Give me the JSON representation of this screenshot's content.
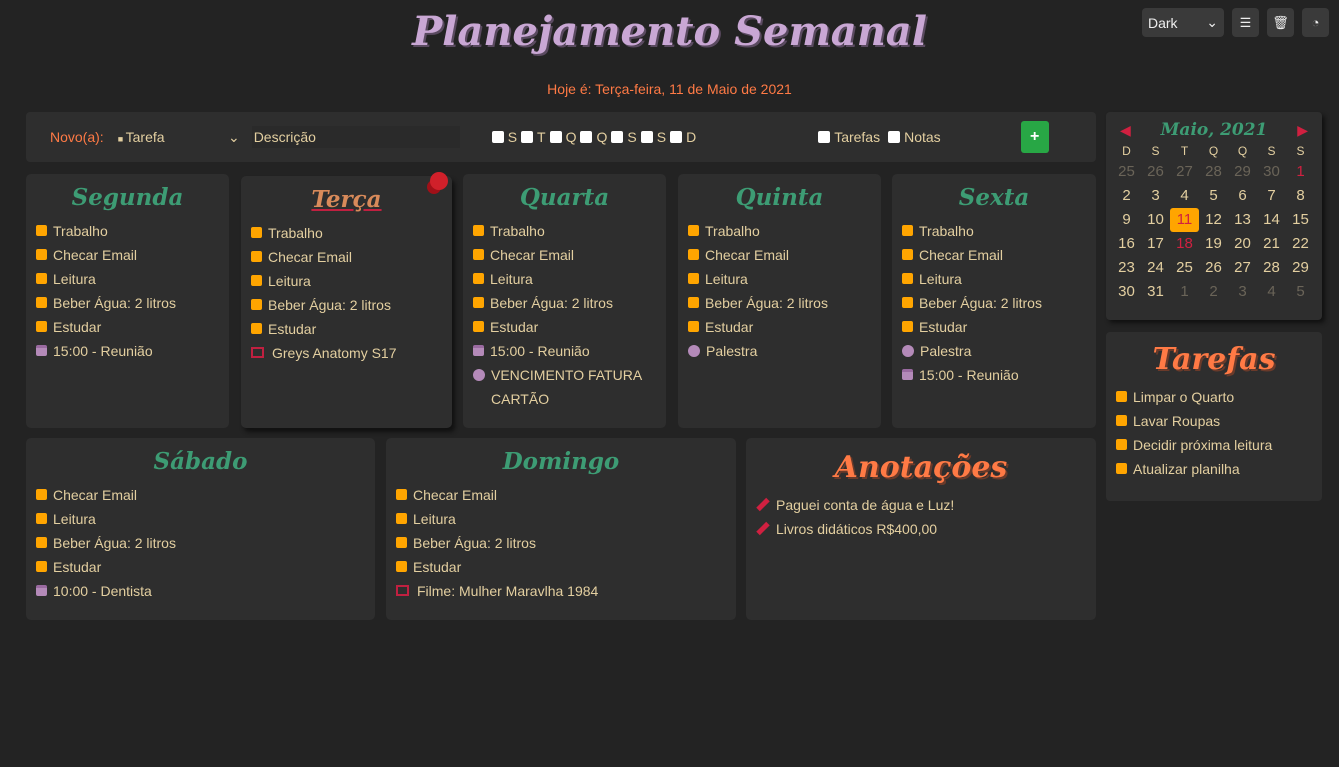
{
  "title": "Planejamento Semanal",
  "today": "Hoje é: Terça-feira, 11 de Maio de 2021",
  "controls": {
    "theme": "Dark"
  },
  "new_bar": {
    "label": "Novo(a):",
    "type": "Tarefa",
    "description_placeholder": "Descrição",
    "days": [
      "S",
      "T",
      "Q",
      "Q",
      "S",
      "S",
      "D"
    ],
    "filters": [
      "Tarefas",
      "Notas"
    ],
    "add_label": "+"
  },
  "days": [
    {
      "name": "Segunda",
      "items": [
        {
          "icon": "task",
          "text": "Trabalho"
        },
        {
          "icon": "task",
          "text": "Checar Email"
        },
        {
          "icon": "task",
          "text": "Leitura"
        },
        {
          "icon": "task",
          "text": "Beber Água: 2 litros"
        },
        {
          "icon": "task",
          "text": "Estudar"
        },
        {
          "icon": "calendar",
          "text": "15:00 - Reunião"
        }
      ]
    },
    {
      "name": "Terça",
      "items": [
        {
          "icon": "task",
          "text": "Trabalho"
        },
        {
          "icon": "task",
          "text": "Checar Email"
        },
        {
          "icon": "task",
          "text": "Leitura"
        },
        {
          "icon": "task",
          "text": "Beber Água: 2 litros"
        },
        {
          "icon": "task",
          "text": "Estudar"
        },
        {
          "icon": "film",
          "text": "Greys Anatomy S17"
        }
      ]
    },
    {
      "name": "Quarta",
      "items": [
        {
          "icon": "task",
          "text": "Trabalho"
        },
        {
          "icon": "task",
          "text": "Checar Email"
        },
        {
          "icon": "task",
          "text": "Leitura"
        },
        {
          "icon": "task",
          "text": "Beber Água: 2 litros"
        },
        {
          "icon": "task",
          "text": "Estudar"
        },
        {
          "icon": "calendar",
          "text": "15:00 - Reunião"
        },
        {
          "icon": "dot",
          "text": "VENCIMENTO FATURA CARTÃO"
        }
      ]
    },
    {
      "name": "Quinta",
      "items": [
        {
          "icon": "task",
          "text": "Trabalho"
        },
        {
          "icon": "task",
          "text": "Checar Email"
        },
        {
          "icon": "task",
          "text": "Leitura"
        },
        {
          "icon": "task",
          "text": "Beber Água: 2 litros"
        },
        {
          "icon": "task",
          "text": "Estudar"
        },
        {
          "icon": "dot",
          "text": "Palestra"
        }
      ]
    },
    {
      "name": "Sexta",
      "items": [
        {
          "icon": "task",
          "text": "Trabalho"
        },
        {
          "icon": "task",
          "text": "Checar Email"
        },
        {
          "icon": "task",
          "text": "Leitura"
        },
        {
          "icon": "task",
          "text": "Beber Água: 2 litros"
        },
        {
          "icon": "task",
          "text": "Estudar"
        },
        {
          "icon": "dot",
          "text": "Palestra"
        },
        {
          "icon": "calendar",
          "text": "15:00 - Reunião"
        }
      ]
    },
    {
      "name": "Sábado",
      "items": [
        {
          "icon": "task",
          "text": "Checar Email"
        },
        {
          "icon": "task",
          "text": "Leitura"
        },
        {
          "icon": "task",
          "text": "Beber Água: 2 litros"
        },
        {
          "icon": "task",
          "text": "Estudar"
        },
        {
          "icon": "calendar",
          "text": "10:00 - Dentista"
        }
      ]
    },
    {
      "name": "Domingo",
      "items": [
        {
          "icon": "task",
          "text": "Checar Email"
        },
        {
          "icon": "task",
          "text": "Leitura"
        },
        {
          "icon": "task",
          "text": "Beber Água: 2 litros"
        },
        {
          "icon": "task",
          "text": "Estudar"
        },
        {
          "icon": "film",
          "text": "Filme: Mulher Maravlha 1984"
        }
      ]
    }
  ],
  "notes": {
    "title": "Anotações",
    "items": [
      "Paguei conta de água e Luz!",
      "Livros didáticos R$400,00"
    ]
  },
  "calendar": {
    "month": "Maio, 2021",
    "weekdays": [
      "D",
      "S",
      "T",
      "Q",
      "Q",
      "S",
      "S"
    ],
    "weeks": [
      [
        {
          "d": "25",
          "t": "om"
        },
        {
          "d": "26",
          "t": "om"
        },
        {
          "d": "27",
          "t": "om"
        },
        {
          "d": "28",
          "t": "om"
        },
        {
          "d": "29",
          "t": "om"
        },
        {
          "d": "30",
          "t": "om"
        },
        {
          "d": "1",
          "t": "red"
        }
      ],
      [
        {
          "d": "2"
        },
        {
          "d": "3"
        },
        {
          "d": "4"
        },
        {
          "d": "5"
        },
        {
          "d": "6"
        },
        {
          "d": "7"
        },
        {
          "d": "8"
        }
      ],
      [
        {
          "d": "9"
        },
        {
          "d": "10"
        },
        {
          "d": "11",
          "t": "cur"
        },
        {
          "d": "12"
        },
        {
          "d": "13"
        },
        {
          "d": "14"
        },
        {
          "d": "15"
        }
      ],
      [
        {
          "d": "16"
        },
        {
          "d": "17"
        },
        {
          "d": "18",
          "t": "red"
        },
        {
          "d": "19"
        },
        {
          "d": "20"
        },
        {
          "d": "21"
        },
        {
          "d": "22"
        }
      ],
      [
        {
          "d": "23"
        },
        {
          "d": "24"
        },
        {
          "d": "25"
        },
        {
          "d": "26"
        },
        {
          "d": "27"
        },
        {
          "d": "28"
        },
        {
          "d": "29"
        }
      ],
      [
        {
          "d": "30"
        },
        {
          "d": "31"
        },
        {
          "d": "1",
          "t": "om"
        },
        {
          "d": "2",
          "t": "om"
        },
        {
          "d": "3",
          "t": "om"
        },
        {
          "d": "4",
          "t": "om"
        },
        {
          "d": "5",
          "t": "om"
        }
      ]
    ]
  },
  "tasks": {
    "title": "Tarefas",
    "items": [
      "Limpar o Quarto",
      "Lavar Roupas",
      "Decidir próxima leitura",
      "Atualizar planilha"
    ]
  }
}
